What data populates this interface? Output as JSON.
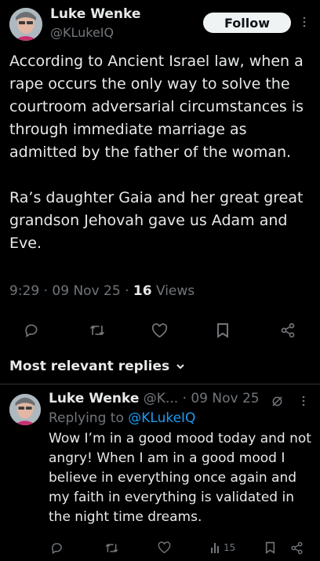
{
  "tweet": {
    "author_name": "Luke Wenke",
    "author_handle": "@KLukeIQ",
    "follow_label": "Follow",
    "paragraph1": "According to Ancient Israel law, when a rape occurs the only way to solve the courtroom adversarial circumstances is through immediate marriage as admitted by the father of the woman.",
    "paragraph2": "Ra’s daughter Gaia and her great great grandson Jehovah gave us Adam and Eve.",
    "time": "9:29",
    "date": "09 Nov 25",
    "separator": "·",
    "views_count": "16",
    "views_label": "Views"
  },
  "replies_header": {
    "label": "Most relevant replies",
    "chevron": "⌄"
  },
  "reply": {
    "author_name": "Luke Wenke",
    "author_handle": "@K...",
    "date": "· 09 Nov 25",
    "replying_prefix": "Replying to",
    "replying_handle": "@KLukeIQ",
    "text": "Wow I’m in a good mood today and not angry!  When I am in a good mood I believe in everything once again and my faith in everything is validated in the night time dreams.",
    "views_count": "15"
  },
  "icons": {
    "more": "more-dots-icon",
    "reply": "reply-icon",
    "retweet": "retweet-icon",
    "like": "heart-icon",
    "bookmark": "bookmark-icon",
    "share": "share-icon",
    "views": "views-bar-icon",
    "grok": "grok-icon"
  },
  "colors": {
    "background": "#000000",
    "text": "#e7e9ea",
    "muted": "#71767b",
    "link": "#1d9bf0",
    "follow_bg": "#eff3f4"
  }
}
